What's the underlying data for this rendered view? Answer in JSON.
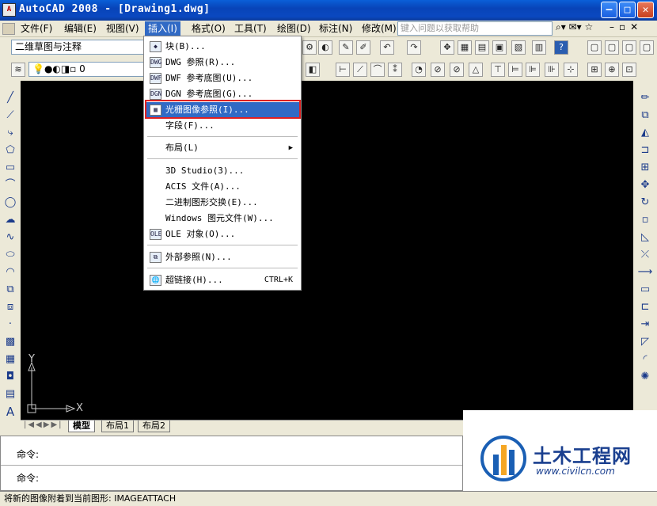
{
  "window": {
    "title": "AutoCAD 2008 - [Drawing1.dwg]",
    "app_icon": "acad-icon"
  },
  "menubar": {
    "items": [
      "文件(F)",
      "编辑(E)",
      "视图(V)",
      "插入(I)",
      "格式(O)",
      "工具(T)",
      "绘图(D)",
      "标注(N)",
      "修改(M)"
    ],
    "active_index": 3,
    "help_placeholder": "键入问题以获取帮助"
  },
  "toolbar": {
    "workspace": "二维草图与注释",
    "layer": "0"
  },
  "insert_menu": {
    "items": [
      {
        "label": "块(B)...",
        "icon": "block-icon"
      },
      {
        "label": "DWG 参照(R)...",
        "icon": "dwg-icon"
      },
      {
        "label": "DWF 参考底图(U)...",
        "icon": "dwf-icon"
      },
      {
        "label": "DGN 参考底图(G)...",
        "icon": "dgn-icon"
      },
      {
        "label": "光栅图像参照(I)...",
        "icon": "raster-image-icon",
        "highlighted": true
      },
      {
        "label": "字段(F)..."
      },
      {
        "label": "布局(L)",
        "submenu": true
      },
      {
        "label": "3D Studio(3)..."
      },
      {
        "label": "ACIS 文件(A)..."
      },
      {
        "label": "二进制图形交换(E)..."
      },
      {
        "label": "Windows 图元文件(W)..."
      },
      {
        "label": "OLE 对象(O)...",
        "icon": "ole-icon"
      },
      {
        "label": "外部参照(N)...",
        "icon": "xref-icon"
      },
      {
        "label": "超链接(H)...",
        "icon": "hyperlink-icon",
        "shortcut": "CTRL+K"
      }
    ]
  },
  "ucs": {
    "x_label": "X",
    "y_label": "Y"
  },
  "tabs": [
    "模型",
    "布局1",
    "布局2"
  ],
  "command": {
    "line1": "命令:",
    "line2": "命令:"
  },
  "status": {
    "text": "将新的图像附着到当前图形:  IMAGEATTACH"
  },
  "watermark": {
    "brand": "土木工程网",
    "url": "www.civilcn.com"
  },
  "colors": {
    "highlight": "#316ac5",
    "callout": "#e02020",
    "canvas": "#000000"
  }
}
